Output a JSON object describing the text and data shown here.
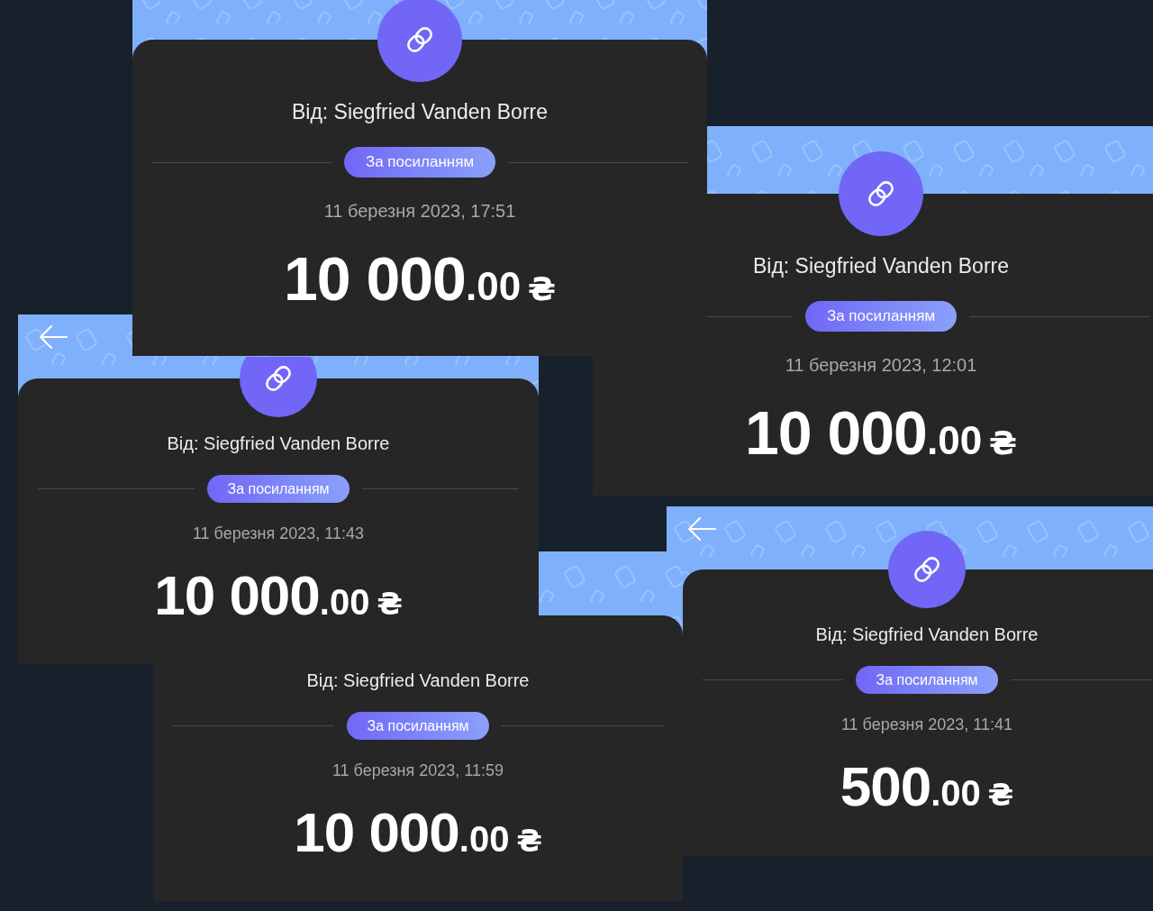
{
  "screenshots": [
    {
      "sender": "Від: Siegfried Vanden Borre",
      "tag": "За посиланням",
      "date": "11 березня 2023, 17:51",
      "amount_whole": "10 000",
      "amount_fraction": ".00",
      "currency": "₴"
    },
    {
      "sender": "Від: Siegfried Vanden Borre",
      "tag": "За посиланням",
      "date": "11 березня 2023, 12:01",
      "amount_whole": "10 000",
      "amount_fraction": ".00",
      "currency": "₴"
    },
    {
      "sender": "Від: Siegfried Vanden Borre",
      "tag": "За посиланням",
      "date": "11 березня 2023, 11:43",
      "amount_whole": "10 000",
      "amount_fraction": ".00",
      "currency": "₴"
    },
    {
      "sender": "Від: Siegfried Vanden Borre",
      "tag": "За посиланням",
      "date": "11 березня 2023, 11:59",
      "amount_whole": "10 000",
      "amount_fraction": ".00",
      "currency": "₴"
    },
    {
      "sender": "Від: Siegfried Vanden Borre",
      "tag": "За посиланням",
      "date": "11 березня 2023, 11:41",
      "amount_whole": "500",
      "amount_fraction": ".00",
      "currency": "₴"
    }
  ]
}
